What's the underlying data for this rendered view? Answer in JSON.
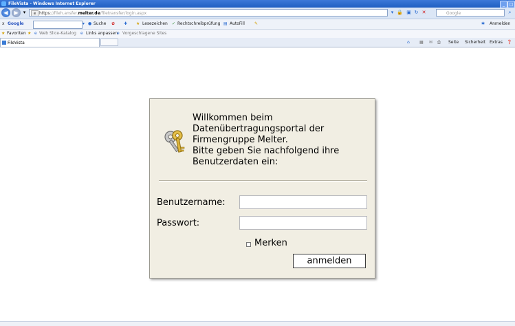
{
  "window": {
    "title": "FileVista - Windows Internet Explorer"
  },
  "addressbar": {
    "protocol": "https",
    "url_dim": "://fileh.ansfer.",
    "url_host": "melter.de",
    "url_path": "/filetransfer/login.aspx",
    "search_placeholder": "Google"
  },
  "toolbar": {
    "close_x": "x",
    "google_label": "Google",
    "suche_label": "Suche",
    "lesezeichen_label": "Lesezeichen",
    "rechtschreib_label": "Rechtschreibprüfung",
    "autofill_label": "AutoFill",
    "anmelden_label": "Anmelden"
  },
  "favorites": {
    "favoriten_label": "Favoriten",
    "webslice_label": "Web Slice-Katalog",
    "links_label": "Links anpassen",
    "suggested_label": "Vorgeschlagene Sites"
  },
  "tab": {
    "label": "FileVista",
    "seite_label": "Seite",
    "sicherheit_label": "Sicherheit",
    "extras_label": "Extras"
  },
  "login": {
    "welcome": "Willkommen beim\nDatenübertragungsportal der\nFirmengruppe Melter.\nBitte geben Sie nachfolgend ihre\nBenutzerdaten ein:",
    "username_label": "Benutzername:",
    "username_value": "",
    "password_label": "Passwort:",
    "password_value": "",
    "remember_label": "Merken",
    "remember_checked": false,
    "submit_label": "anmelden"
  }
}
